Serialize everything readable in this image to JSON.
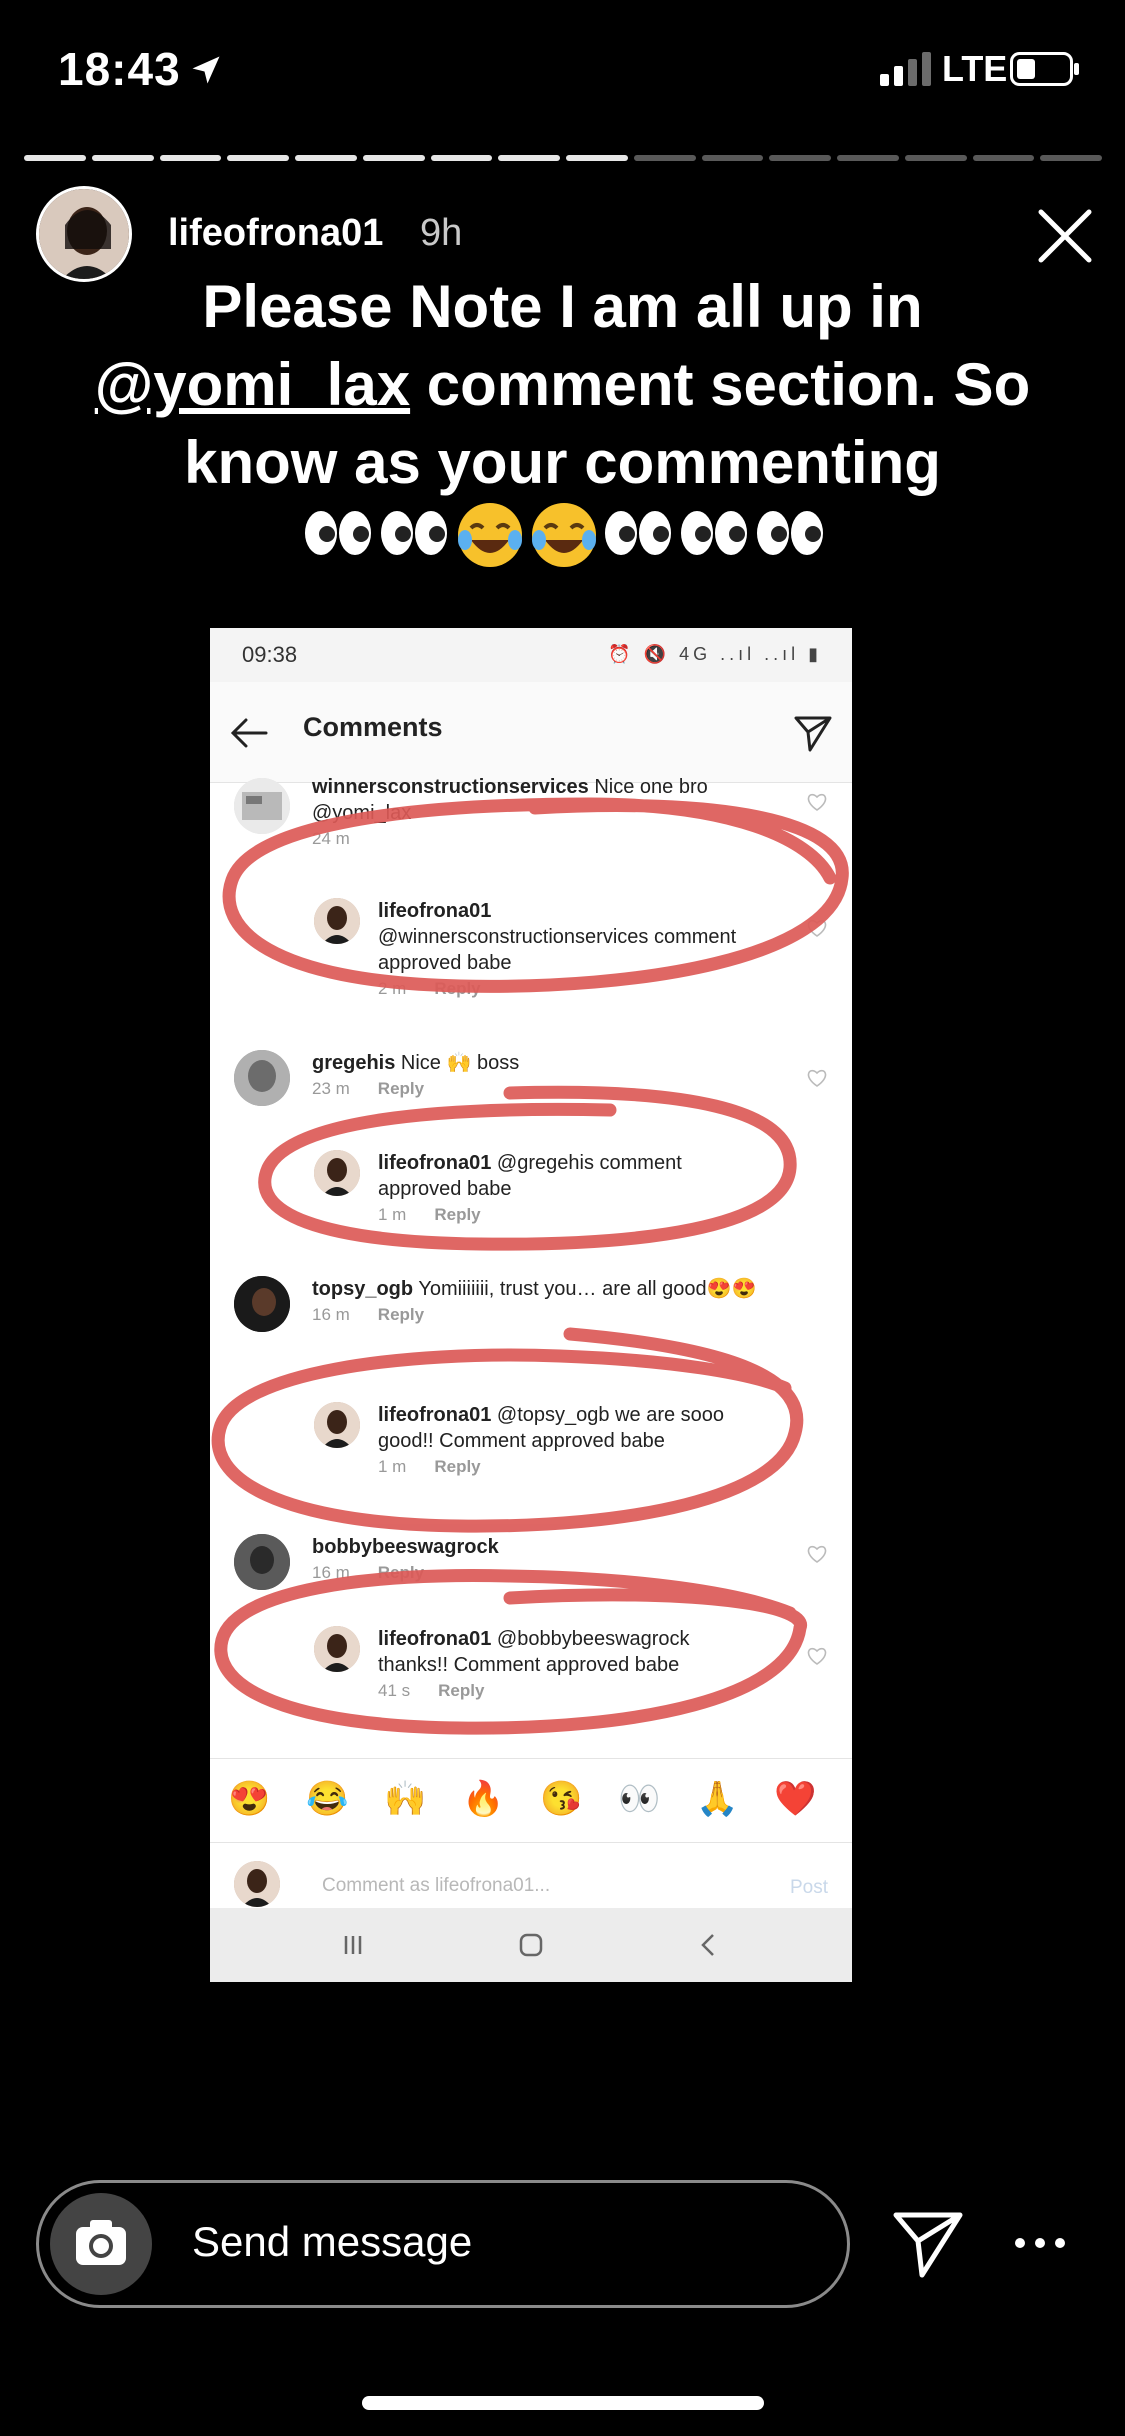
{
  "status_bar": {
    "time": "18:43",
    "network": "LTE"
  },
  "story": {
    "progress_total": 16,
    "progress_done": 9,
    "username": "lifeofrona01",
    "time_ago": "9h",
    "caption_prefix": "Please Note I am all up in",
    "caption_mention": "@yomi_lax",
    "caption_suffix": "comment section. So know as your commenting"
  },
  "embedded_screenshot": {
    "status_time": "09:38",
    "status_icons": "⏰ 🔇 4G ..ıl ..ıl ▮",
    "title": "Comments",
    "comments": [
      {
        "user": "winnersconstructionservices",
        "text": "Nice one bro @yomi_lax",
        "age": "24 m"
      },
      {
        "user": "lifeofrona01",
        "text": "@winnersconstructionservices comment approved babe",
        "age": "2 m",
        "reply": "Reply"
      },
      {
        "user": "gregehis",
        "text": "Nice 🙌 boss",
        "age": "23 m",
        "reply": "Reply"
      },
      {
        "user": "lifeofrona01",
        "text": "@gregehis comment approved babe",
        "age": "1 m",
        "reply": "Reply"
      },
      {
        "user": "topsy_ogb",
        "text": "Yomiiiiiii, trust you… are all good😍😍",
        "age": "16 m",
        "reply": "Reply"
      },
      {
        "user": "lifeofrona01",
        "text": "@topsy_ogb we are sooo good!! Comment approved babe",
        "age": "1 m",
        "reply": "Reply"
      },
      {
        "user": "bobbybeeswagrock",
        "text": "",
        "age": "16 m",
        "reply": "Reply"
      },
      {
        "user": "lifeofrona01",
        "text": "@bobbybeeswagrock thanks!! Comment approved babe",
        "age": "41 s",
        "reply": "Reply"
      }
    ],
    "quick_emojis": [
      "😍",
      "😂",
      "🙌",
      "🔥",
      "😘",
      "👀",
      "🙏",
      "❤️"
    ],
    "comment_placeholder": "Comment as lifeofrona01...",
    "post_label": "Post"
  },
  "reply_bar": {
    "placeholder": "Send message"
  }
}
